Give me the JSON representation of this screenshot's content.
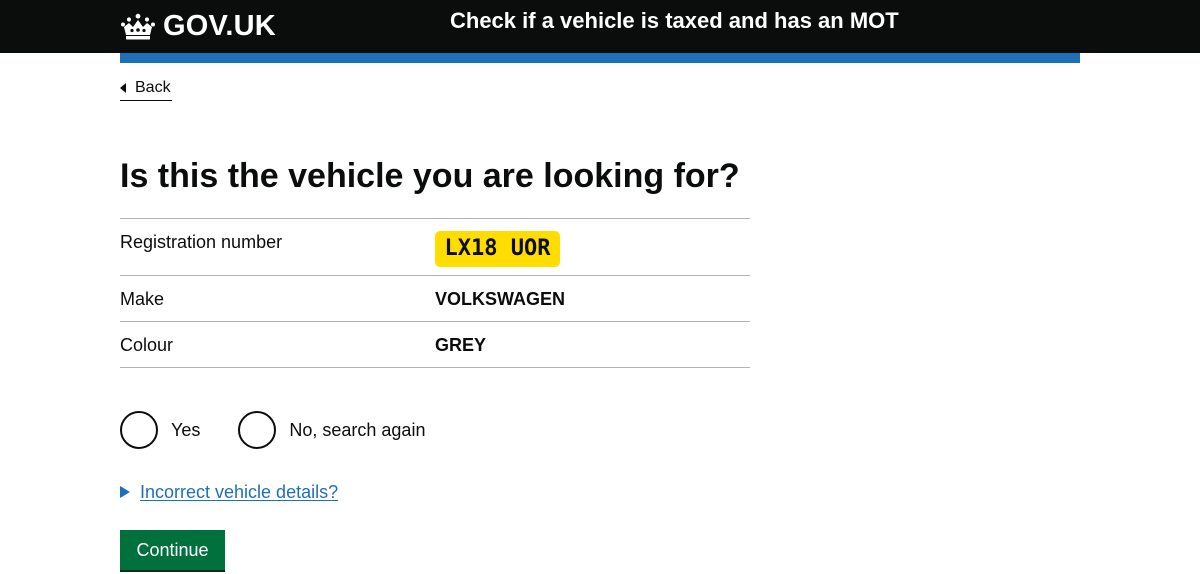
{
  "header": {
    "logo_text": "GOV.UK",
    "service_name": "Check if a vehicle is taxed and has an MOT",
    "logo_icon": "crown-icon"
  },
  "back": {
    "label": "Back",
    "icon": "chevron-left-icon"
  },
  "main": {
    "heading": "Is this the vehicle you are looking for?",
    "summary": {
      "registration_label": "Registration number",
      "registration_value": "LX18 UOR",
      "make_label": "Make",
      "make_value": "VOLKSWAGEN",
      "colour_label": "Colour",
      "colour_value": "GREY"
    },
    "radios": [
      {
        "label": "Yes",
        "selected": false
      },
      {
        "label": "No, search again",
        "selected": false
      }
    ],
    "details_link": "Incorrect vehicle details?",
    "continue_label": "Continue"
  },
  "colors": {
    "header_bg": "#0b0c0c",
    "accent_blue": "#1d70b8",
    "plate_yellow": "#ffdd00",
    "button_green": "#00703c"
  }
}
